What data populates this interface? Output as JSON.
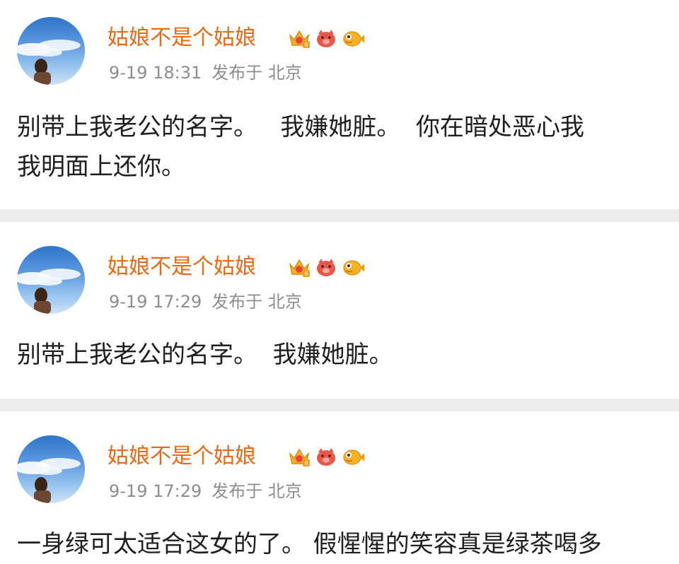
{
  "posts": [
    {
      "username": "姑娘不是个姑娘",
      "time": "9-19 18:31",
      "location_prefix": "发布于",
      "location": "北京",
      "content_lines": [
        "别带上我老公的名字。   我嫌她脏。  你在暗处恶心我",
        "我明面上还你。"
      ],
      "badge_icons": [
        "crown-vip-icon",
        "pig-icon",
        "fish-icon"
      ]
    },
    {
      "username": "姑娘不是个姑娘",
      "time": "9-19 17:29",
      "location_prefix": "发布于",
      "location": "北京",
      "content_lines": [
        "别带上我老公的名字。  我嫌她脏。"
      ],
      "badge_icons": [
        "crown-vip-icon",
        "pig-icon",
        "fish-icon"
      ]
    },
    {
      "username": "姑娘不是个姑娘",
      "time": "9-19 17:29",
      "location_prefix": "发布于",
      "location": "北京",
      "content_lines": [
        "一身绿可太适合这女的了。 假惺惺的笑容真是绿茶喝多"
      ],
      "badge_icons": [
        "crown-vip-icon",
        "pig-icon",
        "fish-icon"
      ]
    }
  ],
  "colors": {
    "username": "#e86a16",
    "meta": "#8d8d8d",
    "text": "#1f1f1f",
    "divider": "#ececec"
  }
}
